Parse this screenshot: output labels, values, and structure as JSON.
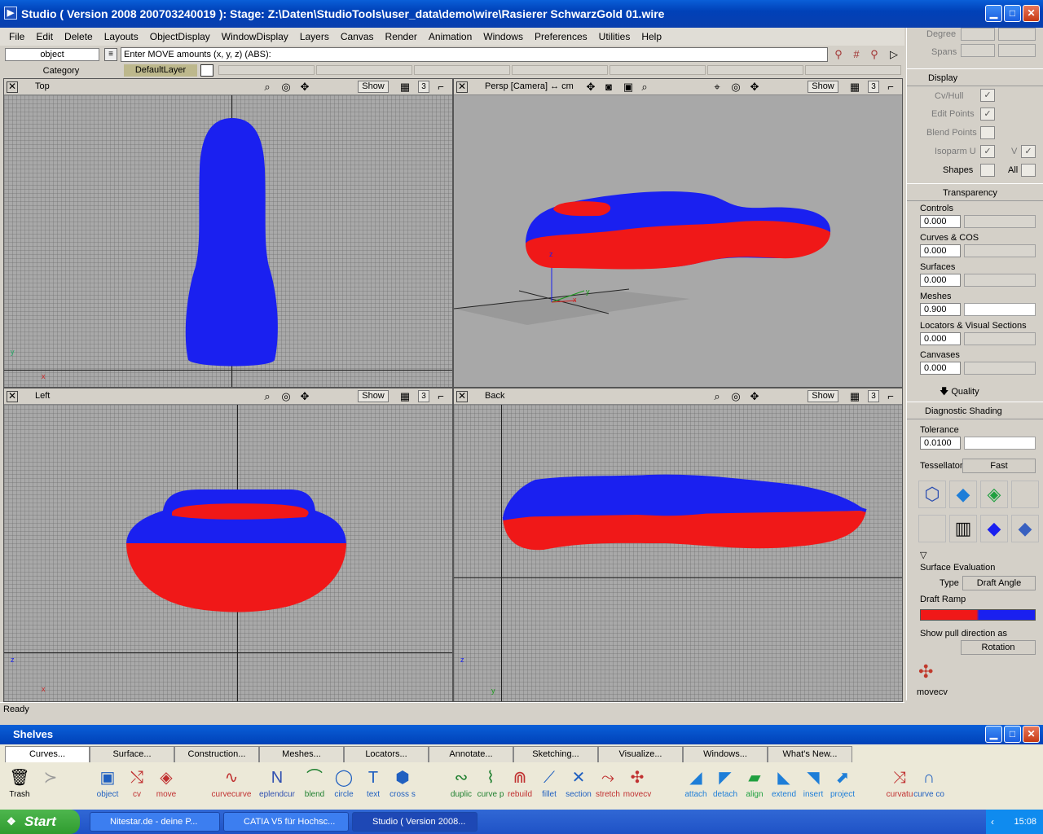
{
  "window": {
    "title": "Studio ( Version 2008  200703240019 ): Stage: Z:\\Daten\\StudioTools\\user_data\\demo\\wire\\Rasierer SchwarzGold 01.wire",
    "min": "▁",
    "max": "□",
    "close": "✕"
  },
  "menu": [
    "File",
    "Edit",
    "Delete",
    "Layouts",
    "ObjectDisplay",
    "WindowDisplay",
    "Layers",
    "Canvas",
    "Render",
    "Animation",
    "Windows",
    "Preferences",
    "Utilities",
    "Help"
  ],
  "command": {
    "mode": "object",
    "prompt": "Enter MOVE amounts (x, y, z) (ABS):",
    "play": "▷"
  },
  "layers": {
    "category": "Category",
    "default_layer": "DefaultLayer"
  },
  "viewports": {
    "top": {
      "title": "Top",
      "show": "Show",
      "num": "3",
      "ax1": "y",
      "ax2": "x"
    },
    "persp": {
      "title": "Persp [Camera] ↔ cm",
      "show": "Show",
      "num": "3",
      "ax1": "z",
      "ax2": "y",
      "ax3": "x"
    },
    "left": {
      "title": "Left",
      "show": "Show",
      "num": "3",
      "ax1": "z",
      "ax2": "x"
    },
    "back": {
      "title": "Back",
      "show": "Show",
      "num": "3",
      "ax1": "z",
      "ax2": "y"
    }
  },
  "panel": {
    "degree": "Degree",
    "spans": "Spans",
    "display": {
      "header": "Display",
      "cvhull": "Cv/Hull",
      "edit_points": "Edit Points",
      "blend_points": "Blend Points",
      "isoparm_u": "Isoparm U",
      "v": "V",
      "shapes": "Shapes",
      "all": "All",
      "check": "✓"
    },
    "transparency": {
      "header": "Transparency",
      "rows": [
        {
          "label": "Controls",
          "value": "0.000"
        },
        {
          "label": "Curves & COS",
          "value": "0.000"
        },
        {
          "label": "Surfaces",
          "value": "0.000"
        },
        {
          "label": "Meshes",
          "value": "0.900"
        },
        {
          "label": "Locators & Visual Sections",
          "value": "0.000"
        },
        {
          "label": "Canvases",
          "value": "0.000"
        }
      ],
      "quality": "Quality"
    },
    "diagnostic": {
      "header": "Diagnostic Shading",
      "tolerance": "Tolerance",
      "tolerance_value": "0.0100",
      "tessellator": "Tessellator",
      "tessellator_value": "Fast"
    },
    "surface_eval": {
      "header": "Surface Evaluation",
      "type_label": "Type",
      "type_value": "Draft Angle",
      "ramp": "Draft Ramp",
      "pull": "Show pull direction as",
      "pull_value": "Rotation"
    },
    "active_tool": "movecv"
  },
  "status": "Ready",
  "shelves": {
    "title": "Shelves",
    "tabs": [
      "Curves...",
      "Surface...",
      "Construction...",
      "Meshes...",
      "Locators...",
      "Annotate...",
      "Sketching...",
      "Visualize...",
      "Windows...",
      "What's New..."
    ],
    "tools": [
      {
        "label": "Trash",
        "icon": "🗑"
      },
      {
        "label": "",
        "icon": "≻"
      },
      {
        "label": "object",
        "icon": "▣"
      },
      {
        "label": "cv",
        "icon": "⤭"
      },
      {
        "label": "move",
        "icon": "◈"
      },
      {
        "label": "curvecurve",
        "icon": "∿"
      },
      {
        "label": "eplendcur",
        "icon": "Ν"
      },
      {
        "label": "blend",
        "icon": "⌒"
      },
      {
        "label": "circle",
        "icon": "◯"
      },
      {
        "label": "text",
        "icon": "T"
      },
      {
        "label": "cross s",
        "icon": "⬢"
      },
      {
        "label": "duplic",
        "icon": "∾"
      },
      {
        "label": "curve p",
        "icon": "⌇"
      },
      {
        "label": "rebuild",
        "icon": "⋒"
      },
      {
        "label": "fillet",
        "icon": "⟋"
      },
      {
        "label": "section",
        "icon": "✕"
      },
      {
        "label": "stretch",
        "icon": "⤳"
      },
      {
        "label": "movecv",
        "icon": "✣"
      },
      {
        "label": "attach",
        "icon": "◢"
      },
      {
        "label": "detach",
        "icon": "◤"
      },
      {
        "label": "align",
        "icon": "▰"
      },
      {
        "label": "extend",
        "icon": "◣"
      },
      {
        "label": "insert",
        "icon": "◥"
      },
      {
        "label": "project",
        "icon": "⬈"
      },
      {
        "label": "curvatu",
        "icon": "⤨"
      },
      {
        "label": "curve co",
        "icon": "∩"
      }
    ]
  },
  "taskbar": {
    "start": "Start",
    "tasks": [
      "Nitestar.de - deine P...",
      "CATIA V5 für Hochsc...",
      "Studio ( Version 2008..."
    ],
    "clock": "15:08"
  },
  "colors": {
    "mesh_blue": "#1a20f0",
    "mesh_red": "#f01818"
  }
}
